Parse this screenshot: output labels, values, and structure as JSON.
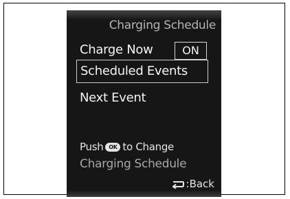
{
  "screen": {
    "title": "Charging Schedule",
    "menu": {
      "charge_now_label": "Charge Now",
      "charge_now_value": "ON",
      "scheduled_events_label": "Scheduled Events",
      "next_event_label": "Next Event"
    },
    "hint": {
      "prefix": "Push",
      "ok_icon": "OK",
      "suffix": "to Change",
      "line2": "Charging Schedule"
    },
    "back_label": ":Back",
    "icons": {
      "back": "return-arrow-icon",
      "ok": "ok-button-icon"
    },
    "colors": {
      "background": "#161616",
      "text": "#f2f2f2",
      "dim_text": "#b5b5b5"
    }
  }
}
